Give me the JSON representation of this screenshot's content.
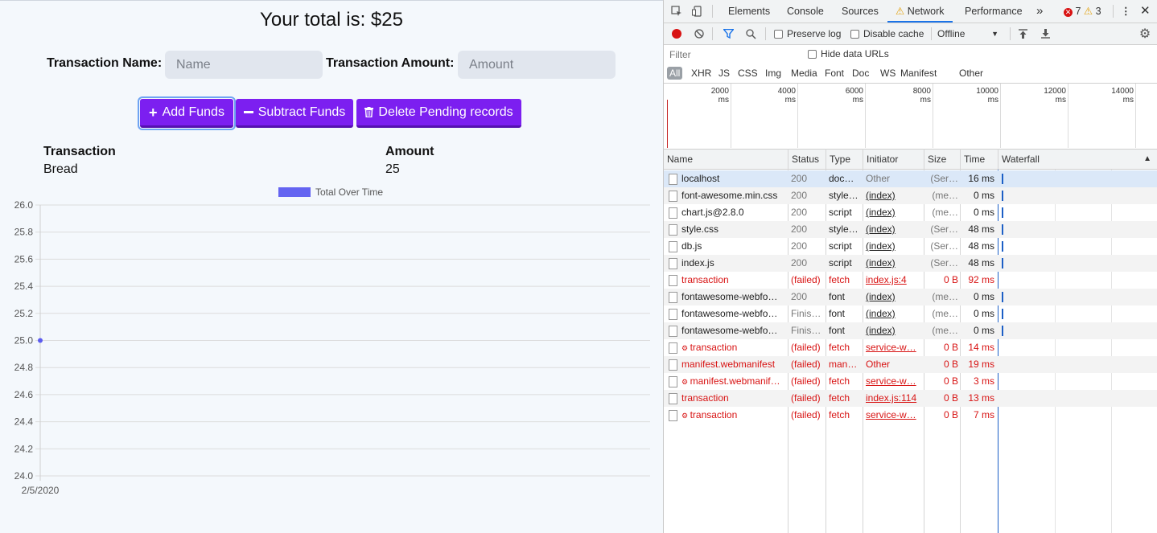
{
  "app": {
    "total_text": "Your total is: $25",
    "name_label": "Transaction Name:",
    "name_placeholder": "Name",
    "amount_label": "Transaction Amount:",
    "amount_placeholder": "Amount",
    "buttons": {
      "add": "Add Funds",
      "subtract": "Subtract Funds",
      "delete": "Delete Pending records"
    },
    "table": {
      "headers": [
        "Transaction",
        "Amount"
      ],
      "rows": [
        [
          "Bread",
          "25"
        ]
      ]
    }
  },
  "chart_data": {
    "type": "line",
    "x": [
      "2/5/2020"
    ],
    "series": [
      {
        "name": "Total Over Time",
        "values": [
          25
        ],
        "color": "#5c5cf0"
      }
    ],
    "ylim": [
      24.0,
      26.0
    ],
    "yticks": [
      "26.0",
      "25.8",
      "25.6",
      "25.4",
      "25.2",
      "25.0",
      "24.8",
      "24.6",
      "24.4",
      "24.2",
      "24.0"
    ],
    "grid": true,
    "legend": "top-center"
  },
  "devtools": {
    "tabs": [
      "Elements",
      "Console",
      "Sources",
      "Network",
      "Performance"
    ],
    "active_tab": "Network",
    "error_count": "7",
    "warning_count": "3",
    "preserve_log": "Preserve log",
    "disable_cache": "Disable cache",
    "throttle": "Offline",
    "filter_placeholder": "Filter",
    "hide_data_urls": "Hide data URLs",
    "types": [
      "All",
      "XHR",
      "JS",
      "CSS",
      "Img",
      "Media",
      "Font",
      "Doc",
      "WS",
      "Manifest",
      "Other"
    ],
    "timeline_labels": [
      "2000 ms",
      "4000 ms",
      "6000 ms",
      "8000 ms",
      "10000 ms",
      "12000 ms",
      "14000 ms"
    ],
    "columns": [
      "Name",
      "Status",
      "Type",
      "Initiator",
      "Size",
      "Time",
      "Waterfall"
    ],
    "requests": [
      {
        "name": "localhost",
        "status": "200",
        "type": "doc…",
        "initiator": "Other",
        "size": "(Ser…",
        "time": "16 ms",
        "failed": false,
        "link": false,
        "sw": false
      },
      {
        "name": "font-awesome.min.css",
        "status": "200",
        "type": "style…",
        "initiator": "(index)",
        "size": "(me…",
        "time": "0 ms",
        "failed": false,
        "link": true,
        "sw": false
      },
      {
        "name": "chart.js@2.8.0",
        "status": "200",
        "type": "script",
        "initiator": "(index)",
        "size": "(me…",
        "time": "0 ms",
        "failed": false,
        "link": true,
        "sw": false
      },
      {
        "name": "style.css",
        "status": "200",
        "type": "style…",
        "initiator": "(index)",
        "size": "(Ser…",
        "time": "48 ms",
        "failed": false,
        "link": true,
        "sw": false
      },
      {
        "name": "db.js",
        "status": "200",
        "type": "script",
        "initiator": "(index)",
        "size": "(Ser…",
        "time": "48 ms",
        "failed": false,
        "link": true,
        "sw": false
      },
      {
        "name": "index.js",
        "status": "200",
        "type": "script",
        "initiator": "(index)",
        "size": "(Ser…",
        "time": "48 ms",
        "failed": false,
        "link": true,
        "sw": false
      },
      {
        "name": "transaction",
        "status": "(failed)",
        "type": "fetch",
        "initiator": "index.js:4",
        "size": "0 B",
        "time": "92 ms",
        "failed": true,
        "link": true,
        "sw": false
      },
      {
        "name": "fontawesome-webfo…",
        "status": "200",
        "type": "font",
        "initiator": "(index)",
        "size": "(me…",
        "time": "0 ms",
        "failed": false,
        "link": true,
        "sw": false
      },
      {
        "name": "fontawesome-webfo…",
        "status": "Finis…",
        "type": "font",
        "initiator": "(index)",
        "size": "(me…",
        "time": "0 ms",
        "failed": false,
        "link": true,
        "sw": false
      },
      {
        "name": "fontawesome-webfo…",
        "status": "Finis…",
        "type": "font",
        "initiator": "(index)",
        "size": "(me…",
        "time": "0 ms",
        "failed": false,
        "link": true,
        "sw": false
      },
      {
        "name": "transaction",
        "status": "(failed)",
        "type": "fetch",
        "initiator": "service-w…",
        "size": "0 B",
        "time": "14 ms",
        "failed": true,
        "link": true,
        "sw": true
      },
      {
        "name": "manifest.webmanifest",
        "status": "(failed)",
        "type": "man…",
        "initiator": "Other",
        "size": "0 B",
        "time": "19 ms",
        "failed": true,
        "link": false,
        "sw": false
      },
      {
        "name": "manifest.webmanif…",
        "status": "(failed)",
        "type": "fetch",
        "initiator": "service-w…",
        "size": "0 B",
        "time": "3 ms",
        "failed": true,
        "link": true,
        "sw": true
      },
      {
        "name": "transaction",
        "status": "(failed)",
        "type": "fetch",
        "initiator": "index.js:114",
        "size": "0 B",
        "time": "13 ms",
        "failed": true,
        "link": true,
        "sw": false
      },
      {
        "name": "transaction",
        "status": "(failed)",
        "type": "fetch",
        "initiator": "service-w…",
        "size": "0 B",
        "time": "7 ms",
        "failed": true,
        "link": true,
        "sw": true
      }
    ],
    "colors": {
      "failed": "#d81313",
      "accent": "#1a73e8",
      "button": "#7c1ff0"
    }
  }
}
